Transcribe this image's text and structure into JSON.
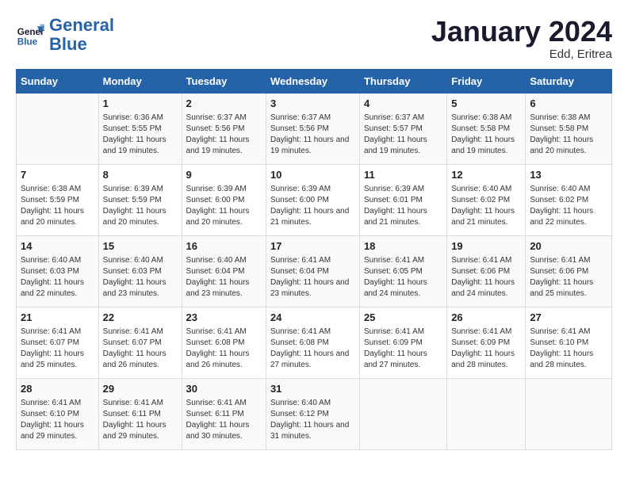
{
  "logo": {
    "line1": "General",
    "line2": "Blue"
  },
  "title": "January 2024",
  "subtitle": "Edd, Eritrea",
  "days_header": [
    "Sunday",
    "Monday",
    "Tuesday",
    "Wednesday",
    "Thursday",
    "Friday",
    "Saturday"
  ],
  "weeks": [
    [
      {
        "num": "",
        "sunrise": "",
        "sunset": "",
        "daylight": ""
      },
      {
        "num": "1",
        "sunrise": "Sunrise: 6:36 AM",
        "sunset": "Sunset: 5:55 PM",
        "daylight": "Daylight: 11 hours and 19 minutes."
      },
      {
        "num": "2",
        "sunrise": "Sunrise: 6:37 AM",
        "sunset": "Sunset: 5:56 PM",
        "daylight": "Daylight: 11 hours and 19 minutes."
      },
      {
        "num": "3",
        "sunrise": "Sunrise: 6:37 AM",
        "sunset": "Sunset: 5:56 PM",
        "daylight": "Daylight: 11 hours and 19 minutes."
      },
      {
        "num": "4",
        "sunrise": "Sunrise: 6:37 AM",
        "sunset": "Sunset: 5:57 PM",
        "daylight": "Daylight: 11 hours and 19 minutes."
      },
      {
        "num": "5",
        "sunrise": "Sunrise: 6:38 AM",
        "sunset": "Sunset: 5:58 PM",
        "daylight": "Daylight: 11 hours and 19 minutes."
      },
      {
        "num": "6",
        "sunrise": "Sunrise: 6:38 AM",
        "sunset": "Sunset: 5:58 PM",
        "daylight": "Daylight: 11 hours and 20 minutes."
      }
    ],
    [
      {
        "num": "7",
        "sunrise": "Sunrise: 6:38 AM",
        "sunset": "Sunset: 5:59 PM",
        "daylight": "Daylight: 11 hours and 20 minutes."
      },
      {
        "num": "8",
        "sunrise": "Sunrise: 6:39 AM",
        "sunset": "Sunset: 5:59 PM",
        "daylight": "Daylight: 11 hours and 20 minutes."
      },
      {
        "num": "9",
        "sunrise": "Sunrise: 6:39 AM",
        "sunset": "Sunset: 6:00 PM",
        "daylight": "Daylight: 11 hours and 20 minutes."
      },
      {
        "num": "10",
        "sunrise": "Sunrise: 6:39 AM",
        "sunset": "Sunset: 6:00 PM",
        "daylight": "Daylight: 11 hours and 21 minutes."
      },
      {
        "num": "11",
        "sunrise": "Sunrise: 6:39 AM",
        "sunset": "Sunset: 6:01 PM",
        "daylight": "Daylight: 11 hours and 21 minutes."
      },
      {
        "num": "12",
        "sunrise": "Sunrise: 6:40 AM",
        "sunset": "Sunset: 6:02 PM",
        "daylight": "Daylight: 11 hours and 21 minutes."
      },
      {
        "num": "13",
        "sunrise": "Sunrise: 6:40 AM",
        "sunset": "Sunset: 6:02 PM",
        "daylight": "Daylight: 11 hours and 22 minutes."
      }
    ],
    [
      {
        "num": "14",
        "sunrise": "Sunrise: 6:40 AM",
        "sunset": "Sunset: 6:03 PM",
        "daylight": "Daylight: 11 hours and 22 minutes."
      },
      {
        "num": "15",
        "sunrise": "Sunrise: 6:40 AM",
        "sunset": "Sunset: 6:03 PM",
        "daylight": "Daylight: 11 hours and 23 minutes."
      },
      {
        "num": "16",
        "sunrise": "Sunrise: 6:40 AM",
        "sunset": "Sunset: 6:04 PM",
        "daylight": "Daylight: 11 hours and 23 minutes."
      },
      {
        "num": "17",
        "sunrise": "Sunrise: 6:41 AM",
        "sunset": "Sunset: 6:04 PM",
        "daylight": "Daylight: 11 hours and 23 minutes."
      },
      {
        "num": "18",
        "sunrise": "Sunrise: 6:41 AM",
        "sunset": "Sunset: 6:05 PM",
        "daylight": "Daylight: 11 hours and 24 minutes."
      },
      {
        "num": "19",
        "sunrise": "Sunrise: 6:41 AM",
        "sunset": "Sunset: 6:06 PM",
        "daylight": "Daylight: 11 hours and 24 minutes."
      },
      {
        "num": "20",
        "sunrise": "Sunrise: 6:41 AM",
        "sunset": "Sunset: 6:06 PM",
        "daylight": "Daylight: 11 hours and 25 minutes."
      }
    ],
    [
      {
        "num": "21",
        "sunrise": "Sunrise: 6:41 AM",
        "sunset": "Sunset: 6:07 PM",
        "daylight": "Daylight: 11 hours and 25 minutes."
      },
      {
        "num": "22",
        "sunrise": "Sunrise: 6:41 AM",
        "sunset": "Sunset: 6:07 PM",
        "daylight": "Daylight: 11 hours and 26 minutes."
      },
      {
        "num": "23",
        "sunrise": "Sunrise: 6:41 AM",
        "sunset": "Sunset: 6:08 PM",
        "daylight": "Daylight: 11 hours and 26 minutes."
      },
      {
        "num": "24",
        "sunrise": "Sunrise: 6:41 AM",
        "sunset": "Sunset: 6:08 PM",
        "daylight": "Daylight: 11 hours and 27 minutes."
      },
      {
        "num": "25",
        "sunrise": "Sunrise: 6:41 AM",
        "sunset": "Sunset: 6:09 PM",
        "daylight": "Daylight: 11 hours and 27 minutes."
      },
      {
        "num": "26",
        "sunrise": "Sunrise: 6:41 AM",
        "sunset": "Sunset: 6:09 PM",
        "daylight": "Daylight: 11 hours and 28 minutes."
      },
      {
        "num": "27",
        "sunrise": "Sunrise: 6:41 AM",
        "sunset": "Sunset: 6:10 PM",
        "daylight": "Daylight: 11 hours and 28 minutes."
      }
    ],
    [
      {
        "num": "28",
        "sunrise": "Sunrise: 6:41 AM",
        "sunset": "Sunset: 6:10 PM",
        "daylight": "Daylight: 11 hours and 29 minutes."
      },
      {
        "num": "29",
        "sunrise": "Sunrise: 6:41 AM",
        "sunset": "Sunset: 6:11 PM",
        "daylight": "Daylight: 11 hours and 29 minutes."
      },
      {
        "num": "30",
        "sunrise": "Sunrise: 6:41 AM",
        "sunset": "Sunset: 6:11 PM",
        "daylight": "Daylight: 11 hours and 30 minutes."
      },
      {
        "num": "31",
        "sunrise": "Sunrise: 6:40 AM",
        "sunset": "Sunset: 6:12 PM",
        "daylight": "Daylight: 11 hours and 31 minutes."
      },
      {
        "num": "",
        "sunrise": "",
        "sunset": "",
        "daylight": ""
      },
      {
        "num": "",
        "sunrise": "",
        "sunset": "",
        "daylight": ""
      },
      {
        "num": "",
        "sunrise": "",
        "sunset": "",
        "daylight": ""
      }
    ]
  ]
}
